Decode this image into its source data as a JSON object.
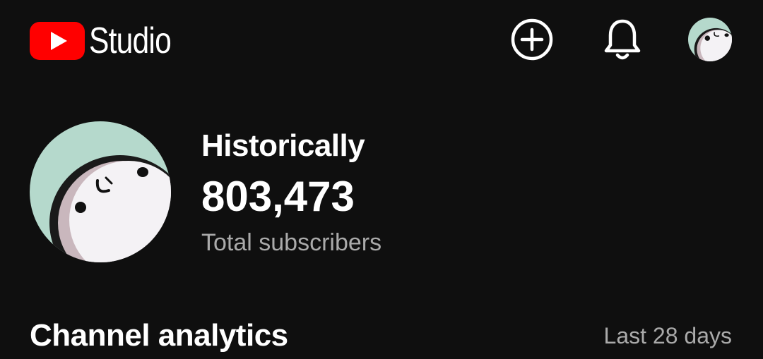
{
  "header": {
    "app_name": "Studio",
    "icons": {
      "logo": "youtube-play-logo",
      "create": "add-circle-icon",
      "notifications": "bell-icon",
      "account": "account-avatar"
    }
  },
  "channel_summary": {
    "label": "Historically",
    "subscriber_count": "803,473",
    "caption": "Total subscribers"
  },
  "analytics": {
    "title": "Channel analytics",
    "period": "Last 28 days"
  },
  "colors": {
    "background": "#0f0f0f",
    "brand_red": "#ff0000",
    "text_primary": "#ffffff",
    "text_secondary": "#aaaaaa",
    "avatar_bg": "#b5d9cc"
  }
}
